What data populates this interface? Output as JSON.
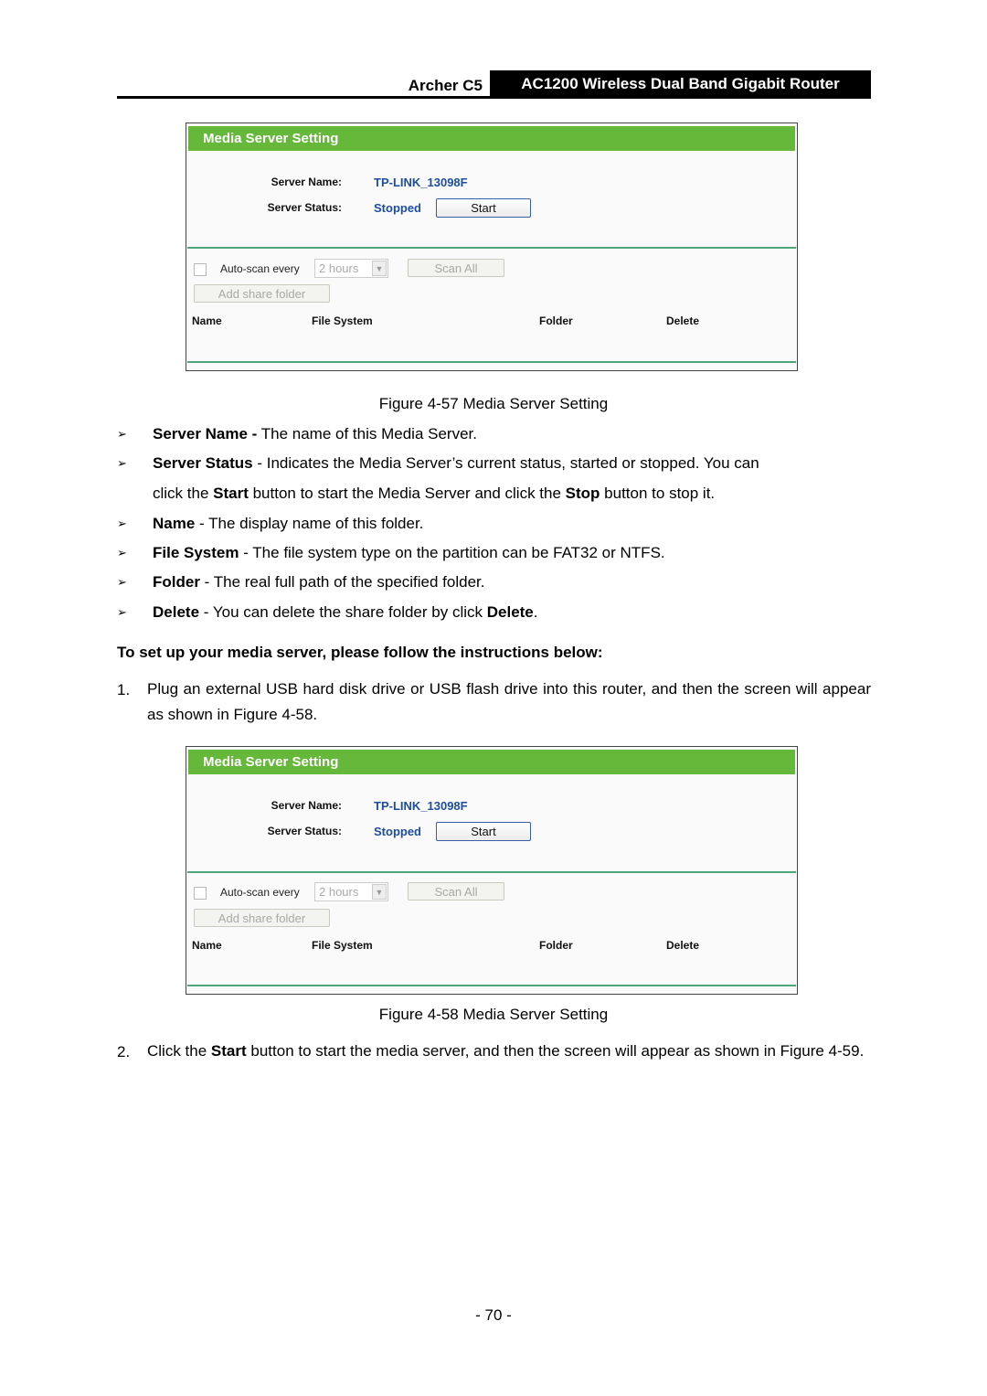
{
  "header": {
    "model": "Archer C5",
    "product": "AC1200 Wireless Dual Band Gigabit Router"
  },
  "figures": [
    {
      "title": "Media Server Setting",
      "server_name_label": "Server Name:",
      "server_name_value": "TP-LINK_13098F",
      "server_status_label": "Server Status:",
      "server_status_value": "Stopped",
      "start_button": "Start",
      "autoscan_label": "Auto-scan every",
      "autoscan_interval": "2 hours",
      "scan_all_button": "Scan All",
      "add_share_folder_button": "Add share folder",
      "columns": [
        "Name",
        "File System",
        "Folder",
        "Delete"
      ],
      "caption": "Figure 4-57 Media Server Setting"
    },
    {
      "title": "Media Server Setting",
      "server_name_label": "Server Name:",
      "server_name_value": "TP-LINK_13098F",
      "server_status_label": "Server Status:",
      "server_status_value": "Stopped",
      "start_button": "Start",
      "autoscan_label": "Auto-scan every",
      "autoscan_interval": "2 hours",
      "scan_all_button": "Scan All",
      "add_share_folder_button": "Add share folder",
      "columns": [
        "Name",
        "File System",
        "Folder",
        "Delete"
      ],
      "caption": "Figure 4-58 Media Server Setting"
    }
  ],
  "bullets": [
    {
      "term": "Server Name -",
      "text": " The name of this Media Server."
    },
    {
      "term": "Server Status",
      "text": " - Indicates the Media Server’s current status, started or stopped. You can"
    },
    {
      "term": "Name",
      "text": " - The display name of this folder."
    },
    {
      "term": "File System",
      "text": " - The file system type on the partition can be FAT32 or NTFS."
    },
    {
      "term": "Folder",
      "text": " - The real full path of the specified folder."
    },
    {
      "term": "Delete",
      "text": " - You can delete the share folder by click ",
      "bold_tail": "Delete",
      "tail": "."
    }
  ],
  "server_status_cont": {
    "a": "click the ",
    "b": "Start",
    "c": " button to start the Media Server and click the ",
    "d": "Stop",
    "e": " button to stop it."
  },
  "bullet_marker": "➢",
  "instructions_heading": "To set up your media server, please follow the instructions below:",
  "steps": [
    {
      "num": "1.",
      "text": "Plug an external USB hard disk drive or USB flash drive into this router, and then the screen will appear as shown in Figure 4-58."
    },
    {
      "num": "2.",
      "pre": "Click the ",
      "bold": "Start",
      "post": " button to start the media server, and then the screen will appear as shown in Figure 4-59."
    }
  ],
  "page_number": "- 70 -"
}
